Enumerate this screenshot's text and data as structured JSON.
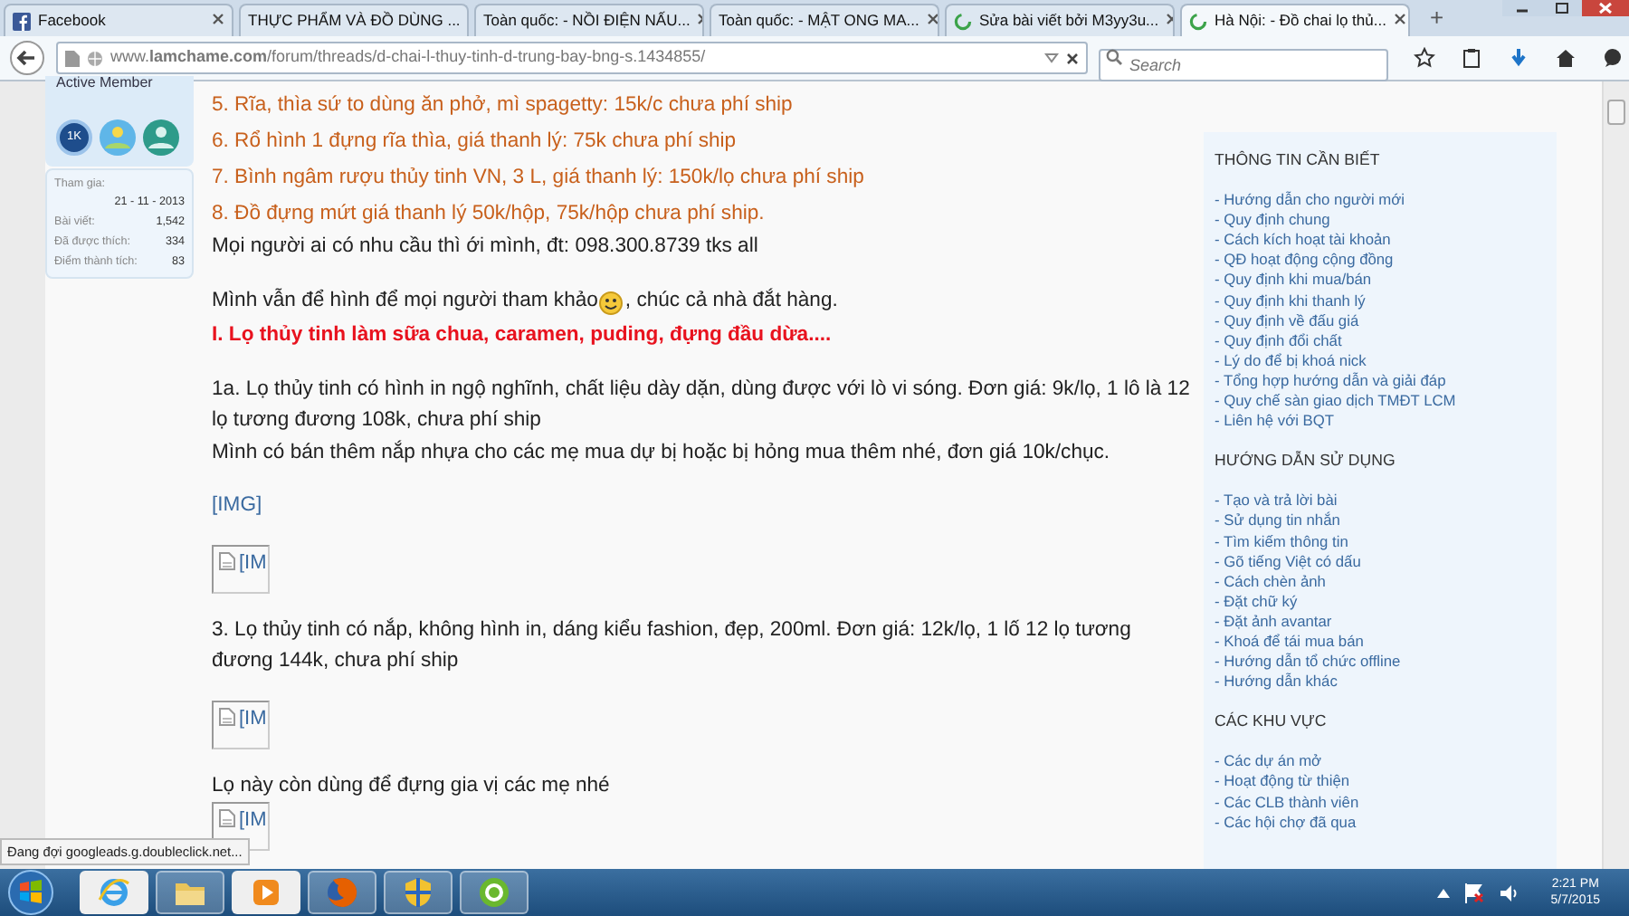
{
  "browser": {
    "tabs": [
      {
        "label": "Facebook",
        "kind": "facebook",
        "selected": false
      },
      {
        "label": "THỰC PHẨM VÀ ĐỒ DÙNG ...",
        "kind": "plain",
        "selected": false
      },
      {
        "label": "Toàn quốc: - NỒI ĐIỆN NẤU...",
        "kind": "plain",
        "selected": false
      },
      {
        "label": "Toàn quốc: - MẬT ONG MA...",
        "kind": "plain",
        "selected": false
      },
      {
        "label": "Sửa bài viết bởi M3yy3u...",
        "kind": "loading",
        "selected": false
      },
      {
        "label": "Hà Nội: - Đồ chai lọ thủ...",
        "kind": "loading",
        "selected": true
      }
    ],
    "new_tab": "+",
    "url": "www.**lamchame.com**/forum/threads/d-chai-l-thuy-tinh-d-trung-bay-bng-s.1434855/",
    "search_placeholder": "Search"
  },
  "user_card": {
    "title": "Active Member",
    "badge_text": "1K",
    "stats": [
      {
        "label": "Tham gia:",
        "value": "21 - 11 - 2013",
        "kind": "stacked"
      },
      {
        "label": "Bài viết:",
        "value": "1,542",
        "kind": "inline"
      },
      {
        "label": "Đã được thích:",
        "value": "334",
        "kind": "inline"
      },
      {
        "label": "Điểm thành tích:",
        "value": "83",
        "kind": "inline"
      }
    ]
  },
  "post": {
    "blocks": [
      {
        "lines": [
          {
            "kind": "list_item",
            "text": "5. Rĩa, thìa sứ to dùng ăn phở, mì spagetty: 15k/c chưa phí ship"
          },
          {
            "kind": "list_item",
            "text": "6. Rổ hình 1 đựng rĩa thìa, giá thanh lý: 75k chưa phí ship"
          },
          {
            "kind": "list_item",
            "text": "7. Bình ngâm rượu thủy tinh VN, 3 L, giá thanh lý: 150k/lọ chưa phí ship"
          },
          {
            "kind": "list_item",
            "text": "8. Đồ đựng mứt giá thanh lý 50k/hộp, 75k/hộp chưa phí ship."
          },
          {
            "kind": "text",
            "text": "Mọi người ai có nhu cầu thì ới mình, đt: 098.300.8739 tks all"
          }
        ]
      },
      {
        "lines": [
          {
            "kind": "smiley_text",
            "text": "Mình vẫn để hình để mọi người tham khảo",
            "text_after": ", chúc cả nhà đắt hàng."
          },
          {
            "kind": "heading",
            "text": "I. Lọ thủy tinh làm sữa chua, caramen, puding, đựng đầu dừa...."
          }
        ]
      },
      {
        "lines": [
          {
            "kind": "text",
            "text": "1a. Lọ thủy tinh có hình in ngộ nghĩnh, chất liệu dày dặn, dùng được với lò vi sóng. Đơn giá: 9k/lọ, 1 lô là 12 lọ tương đương 108k, chưa phí ship"
          },
          {
            "kind": "text",
            "text": "Mình có bán thêm nắp nhựa cho các mẹ mua dự bị hoặc bị hỏng mua thêm nhé, đơn giá 10k/chục."
          }
        ]
      },
      {
        "lines": [
          {
            "kind": "img_link",
            "text": "[IMG]"
          }
        ]
      },
      {
        "lines": [
          {
            "kind": "broken_image",
            "text": "[IM"
          }
        ]
      },
      {
        "lines": [
          {
            "kind": "text",
            "text": "3. Lọ thủy tinh có nắp, không hình in, dáng kiểu fashion, đẹp, 200ml. Đơn giá: 12k/lọ, 1 lố 12 lọ tương đương 144k, chưa phí ship"
          }
        ]
      },
      {
        "lines": [
          {
            "kind": "broken_image",
            "text": "[IM"
          }
        ]
      },
      {
        "lines": [
          {
            "kind": "text",
            "text": "Lọ này còn dùng để đựng gia vị các mẹ nhé"
          },
          {
            "kind": "broken_image",
            "text": "[IM"
          }
        ]
      }
    ]
  },
  "sidebar": {
    "sections": [
      {
        "title": "THÔNG TIN CẦN BIẾT",
        "links": [
          "- Hướng dẫn cho người mới",
          "- Quy định chung",
          "- Cách kích hoạt tài khoản",
          "- QĐ hoạt động cộng đồng",
          "- Quy định khi mua/bán",
          "- Quy định khi thanh lý",
          "- Quy định về đấu giá",
          "- Quy định đổi chất",
          "- Lý do để bị khoá nick",
          "- Tổng hợp hướng dẫn và giải đáp",
          "- Quy chế sàn giao dịch TMĐT LCM",
          "- Liên hệ với BQT"
        ]
      },
      {
        "title": "HƯỚNG DẪN SỬ DỤNG",
        "links": [
          "- Tạo và trả lời bài",
          "- Sử dụng tin nhắn",
          "- Tìm kiếm thông tin",
          "- Gõ tiếng Việt có dấu",
          "- Cách chèn ảnh",
          "- Đặt chữ ký",
          "- Đặt ảnh avantar",
          "- Khoá để tái mua bán",
          "- Hướng dẫn tổ chức offline",
          "- Hướng dẫn khác"
        ]
      },
      {
        "title": "CÁC KHU VỰC",
        "links": [
          "- Các dự án mở",
          "- Hoạt động từ thiện",
          "- Các CLB thành viên",
          "- Các hội chợ đã qua"
        ]
      }
    ]
  },
  "status_text": "Đang đợi googleads.g.doubleclick.net...",
  "taskbar": {
    "apps": [
      {
        "kind": "ie",
        "running": false
      },
      {
        "kind": "folder",
        "running": true
      },
      {
        "kind": "media",
        "running": false
      },
      {
        "kind": "firefox",
        "running": true
      },
      {
        "kind": "shield",
        "running": true
      },
      {
        "kind": "coccoc",
        "running": true
      }
    ],
    "time": "2:21 PM",
    "date": "5/7/2015"
  }
}
